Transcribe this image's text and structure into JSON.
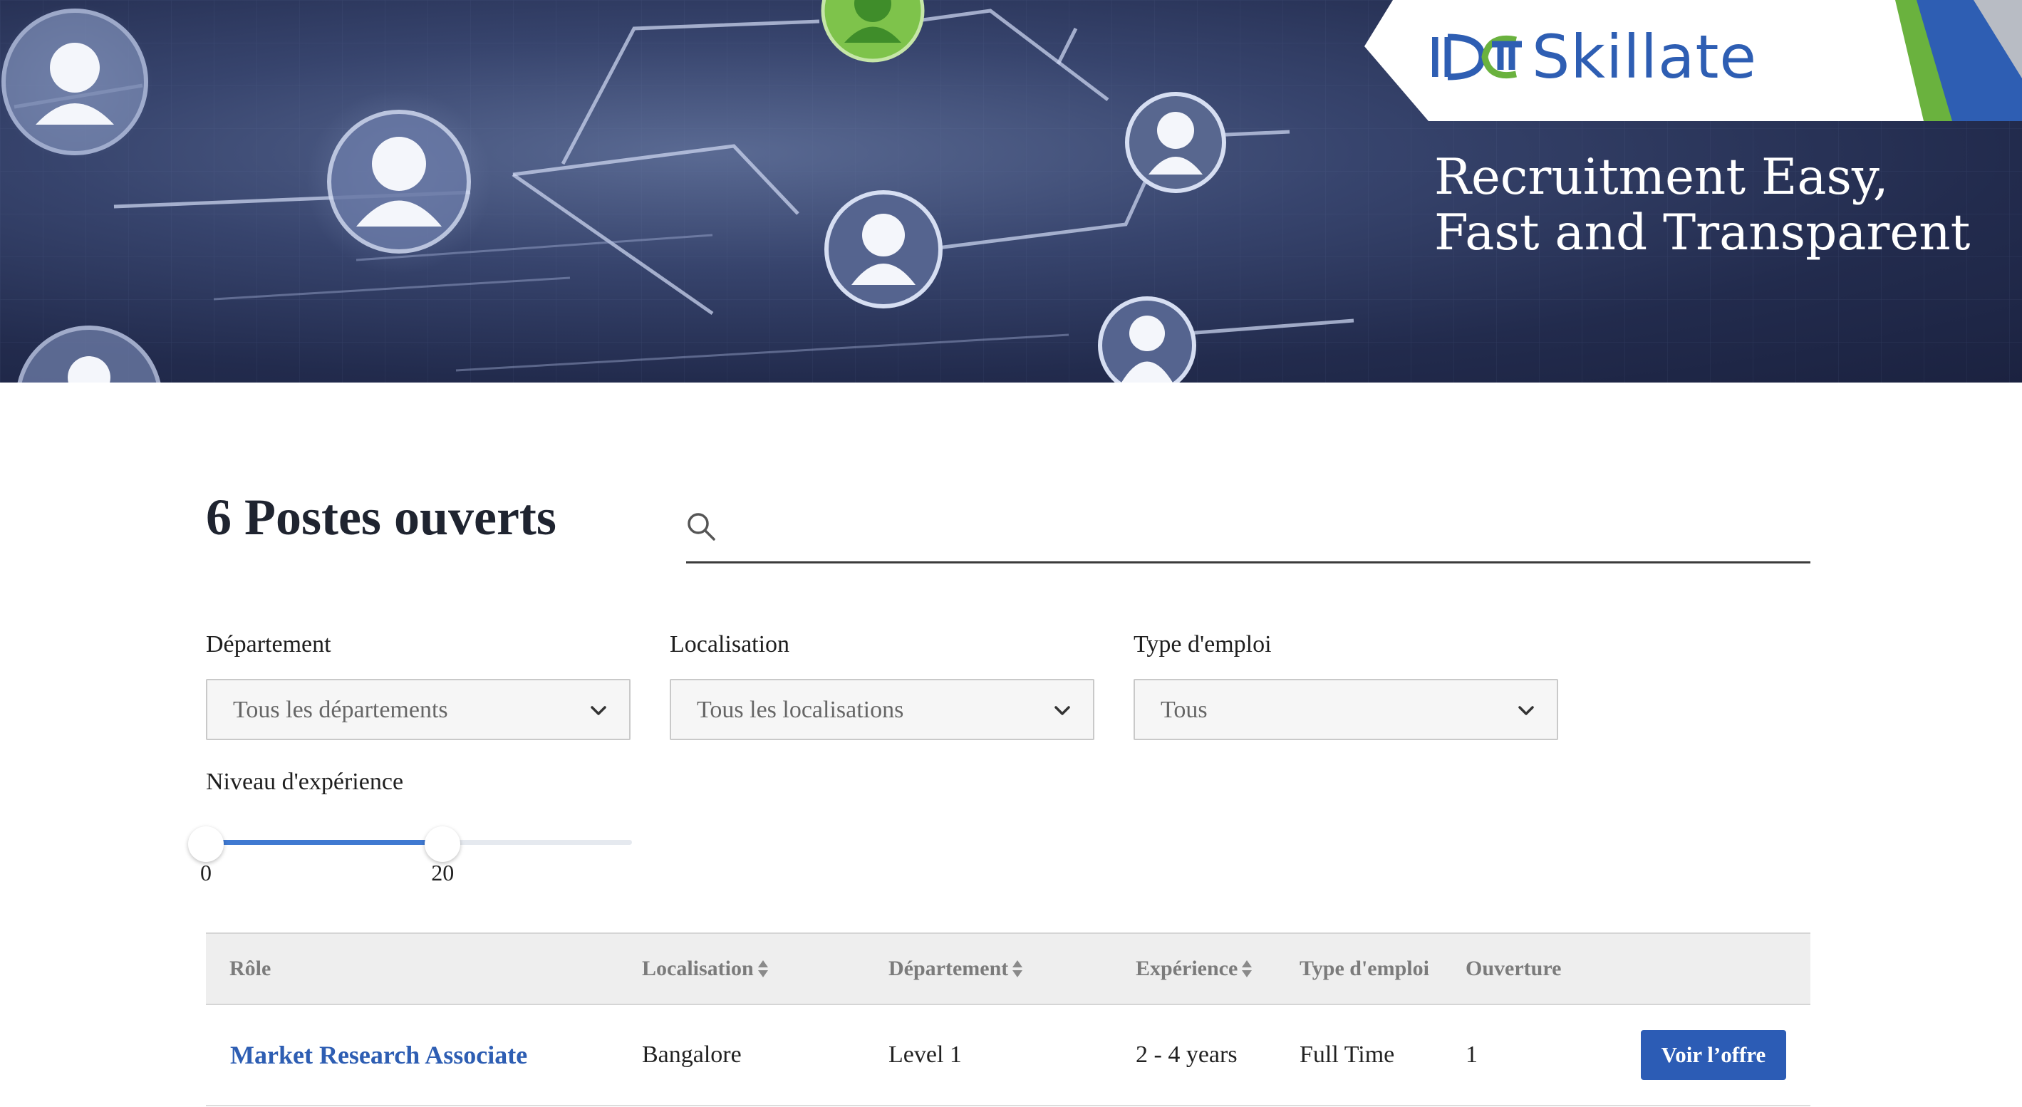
{
  "brand": {
    "name": "Skillate",
    "tagline_lines": [
      "Recruitment Easy,",
      "Fast and Transparent"
    ],
    "colors": {
      "blue": "#2e5eb3",
      "green": "#6ab23e",
      "navy": "#232c4f"
    }
  },
  "header": {
    "title": "6 Postes ouverts"
  },
  "search": {
    "value": "",
    "placeholder": ""
  },
  "filters": {
    "department": {
      "label": "Département",
      "selected": "Tous les départements"
    },
    "location": {
      "label": "Localisation",
      "selected": "Tous les localisations"
    },
    "job_type": {
      "label": "Type d'emploi",
      "selected": "Tous"
    },
    "experience": {
      "label": "Niveau d'expérience",
      "min_label": "0",
      "max_label": "20",
      "min": 0,
      "max": 20,
      "range_max": 36
    }
  },
  "table": {
    "columns": [
      {
        "label": "Rôle",
        "sortable": false
      },
      {
        "label": "Localisation",
        "sortable": true
      },
      {
        "label": "Département",
        "sortable": true
      },
      {
        "label": "Expérience",
        "sortable": true
      },
      {
        "label": "Type d'emploi",
        "sortable": false
      },
      {
        "label": "Ouverture",
        "sortable": false
      }
    ],
    "rows": [
      {
        "role": "Market Research Associate",
        "location": "Bangalore",
        "department": "Level 1",
        "experience": "2 - 4 years",
        "job_type": "Full Time",
        "openings": "1",
        "action": "Voir l’offre"
      }
    ]
  },
  "icons": [
    "search-icon",
    "chevron-down-icon",
    "sort-icon",
    "person-icon"
  ]
}
